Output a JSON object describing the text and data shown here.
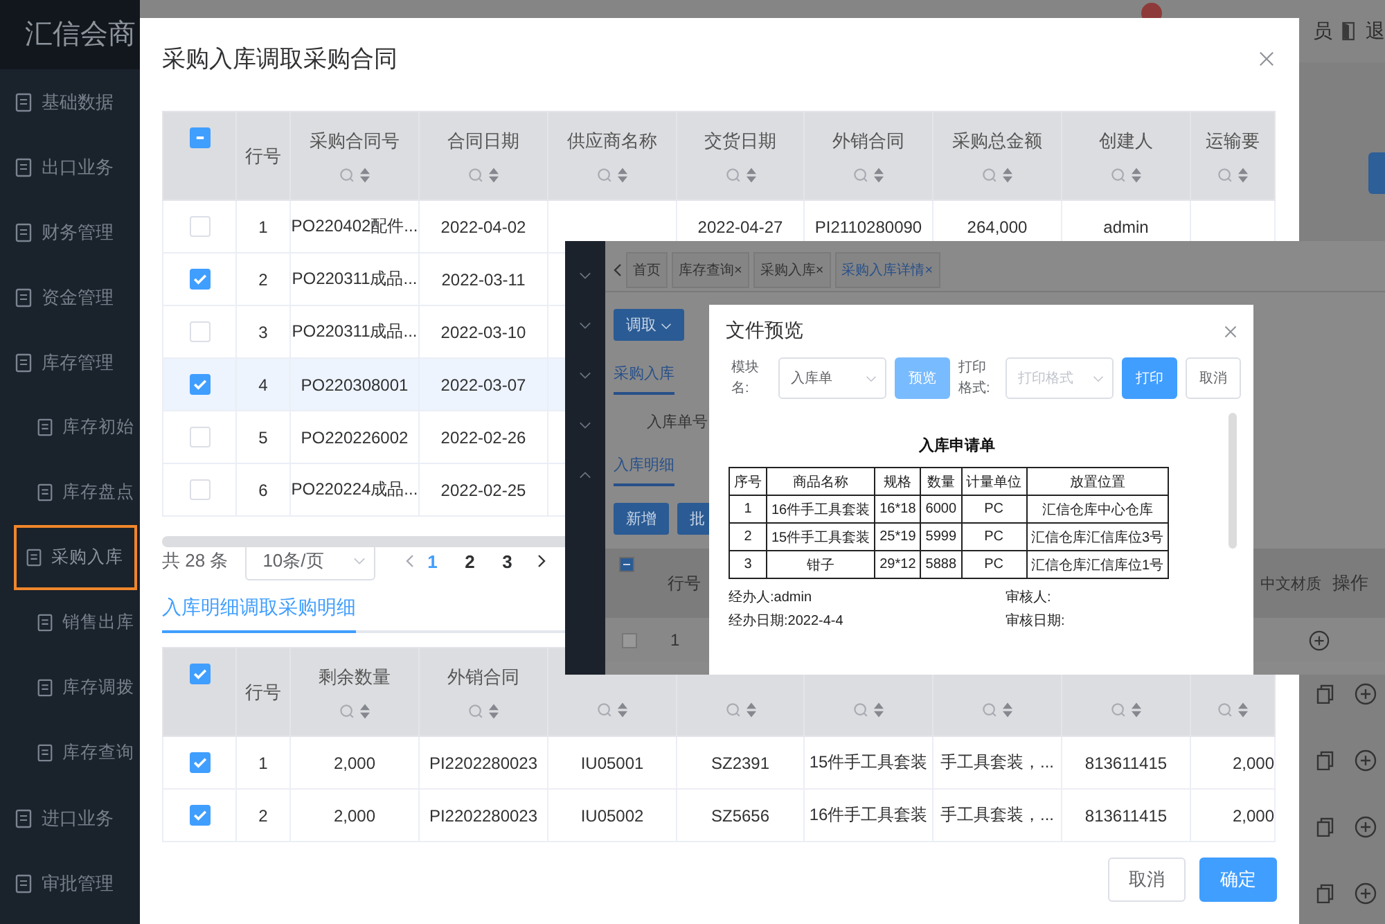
{
  "app": {
    "logo": "汇信会商",
    "menu": [
      {
        "label": "基础数据"
      },
      {
        "label": "出口业务"
      },
      {
        "label": "财务管理"
      },
      {
        "label": "资金管理"
      },
      {
        "label": "库存管理",
        "children": [
          {
            "label": "库存初始",
            "selected": false
          },
          {
            "label": "库存盘点",
            "selected": false
          },
          {
            "label": "采购入库",
            "selected": true
          },
          {
            "label": "销售出库",
            "selected": false
          },
          {
            "label": "库存调拨",
            "selected": false
          },
          {
            "label": "库存查询",
            "selected": false
          }
        ]
      },
      {
        "label": "进口业务"
      },
      {
        "label": "审批管理"
      }
    ],
    "user": "员",
    "logout": "退"
  },
  "dialog": {
    "title": "采购入库调取采购合同",
    "contracts": {
      "header_indeterminate": true,
      "row_header": "行号",
      "columns": [
        "采购合同号",
        "合同日期",
        "供应商名称",
        "交货日期",
        "外销合同",
        "采购总金额",
        "创建人",
        "运输要"
      ],
      "rows": [
        {
          "no": "1",
          "checked": false,
          "highlighted": false,
          "cells": [
            "PO220402配件...",
            "2022-04-02",
            null,
            "2022-04-27",
            "PI2110280090",
            "264,000",
            "admin",
            null
          ]
        },
        {
          "no": "2",
          "checked": true,
          "highlighted": false,
          "cells": [
            "PO220311成品...",
            "2022-03-11"
          ]
        },
        {
          "no": "3",
          "checked": false,
          "highlighted": false,
          "cells": [
            "PO220311成品...",
            "2022-03-10"
          ]
        },
        {
          "no": "4",
          "checked": true,
          "highlighted": true,
          "cells": [
            "PO220308001",
            "2022-03-07"
          ]
        },
        {
          "no": "5",
          "checked": false,
          "highlighted": false,
          "cells": [
            "PO220226002",
            "2022-02-26"
          ]
        },
        {
          "no": "6",
          "checked": false,
          "highlighted": false,
          "cells": [
            "PO220224成品...",
            "2022-02-25"
          ]
        }
      ]
    },
    "pagination": {
      "total": "共 28 条",
      "page_size": "10条/页",
      "pages": [
        {
          "label": "1",
          "selected": true
        },
        {
          "label": "2",
          "selected": false
        },
        {
          "label": "3",
          "selected": false
        }
      ]
    },
    "tabs": [
      {
        "label": "入库明细调取采购明细",
        "selected": true
      }
    ],
    "details": {
      "header_checked": true,
      "row_header": "行号",
      "columns": [
        "剩余数量",
        "外销合同"
      ],
      "rows": [
        {
          "no": "1",
          "checked": true,
          "cells": [
            "2,000",
            "PI2202280023",
            "IU05001",
            "SZ2391",
            "15件手工具套装",
            "手工具套装，...",
            "813611415",
            "2,000"
          ]
        },
        {
          "no": "2",
          "checked": true,
          "cells": [
            "2,000",
            "PI2202280023",
            "IU05002",
            "SZ5656",
            "16件手工具套装",
            "手工具套装，...",
            "813611415",
            "2,000"
          ]
        }
      ]
    },
    "buttons": [
      {
        "label": "取消",
        "kind": "secondary"
      },
      {
        "label": "确定",
        "kind": "primary"
      }
    ]
  },
  "inset": {
    "tabs": [
      {
        "label": "首页",
        "selected": false
      },
      {
        "label": "库存查询×",
        "selected": false
      },
      {
        "label": "采购入库×",
        "selected": false
      },
      {
        "label": "采购入库详情×",
        "selected": true
      }
    ],
    "fetch_button": "调取",
    "subtabs": [
      {
        "label": "采购入库",
        "selected": true
      }
    ],
    "filter_label": "入库单号",
    "detail_tab": {
      "label": "入库明细",
      "selected": true
    },
    "buttons": [
      "新增",
      "批"
    ],
    "table": {
      "header_indeterminate": true,
      "row_header": "行号",
      "material": "中文材质",
      "actions": "操作",
      "row_no": "1",
      "row_checked": false
    },
    "preview": {
      "title": "文件预览",
      "module_label": "模块名:",
      "module_value": "入库单",
      "preview_button": "预览",
      "format_label": "打印格式:",
      "format_placeholder": "打印格式",
      "print_button": "打印",
      "cancel_button": "取消",
      "doc_title": "入库申请单",
      "columns": [
        "序号",
        "商品名称",
        "规格",
        "数量",
        "计量单位",
        "放置位置"
      ],
      "rows": [
        [
          "1",
          "16件手工具套装",
          "16*18",
          "6000",
          "PC",
          "汇信仓库中心仓库"
        ],
        [
          "2",
          "15件手工具套装",
          "25*19",
          "5999",
          "PC",
          "汇信仓库汇信库位3号"
        ],
        [
          "3",
          "钳子",
          "29*12",
          "5888",
          "PC",
          "汇信仓库汇信库位1号"
        ]
      ],
      "handler": "经办人:admin",
      "reviewer": "审核人:",
      "handle_date": "经办日期:2022-4-4",
      "review_date": "审核日期:"
    }
  }
}
